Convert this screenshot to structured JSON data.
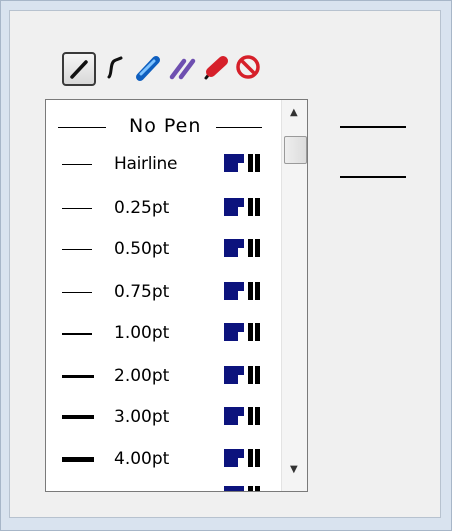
{
  "toolbar": {
    "tools": [
      {
        "name": "pen-tool",
        "selected": true
      },
      {
        "name": "curve-pen-tool",
        "selected": false
      },
      {
        "name": "blue-marker-tool",
        "selected": false
      },
      {
        "name": "purple-double-marker-tool",
        "selected": false
      },
      {
        "name": "red-eraser-tool",
        "selected": false
      },
      {
        "name": "no-pen-tool",
        "selected": false
      }
    ]
  },
  "pen_list": {
    "no_pen_label": "No Pen",
    "items": [
      {
        "label": "Hairline"
      },
      {
        "label": "0.25pt"
      },
      {
        "label": "0.50pt"
      },
      {
        "label": "0.75pt"
      },
      {
        "label": "1.00pt"
      },
      {
        "label": "2.00pt"
      },
      {
        "label": "3.00pt"
      },
      {
        "label": "4.00pt"
      }
    ]
  },
  "colors": {
    "panel_bg": "#d9e3ef",
    "inner_bg": "#f0f0f0",
    "badge_blue": "#0c137d",
    "marker_blue": "#1b74d6",
    "marker_purple": "#6e4fb0",
    "eraser_red": "#d6202a"
  }
}
